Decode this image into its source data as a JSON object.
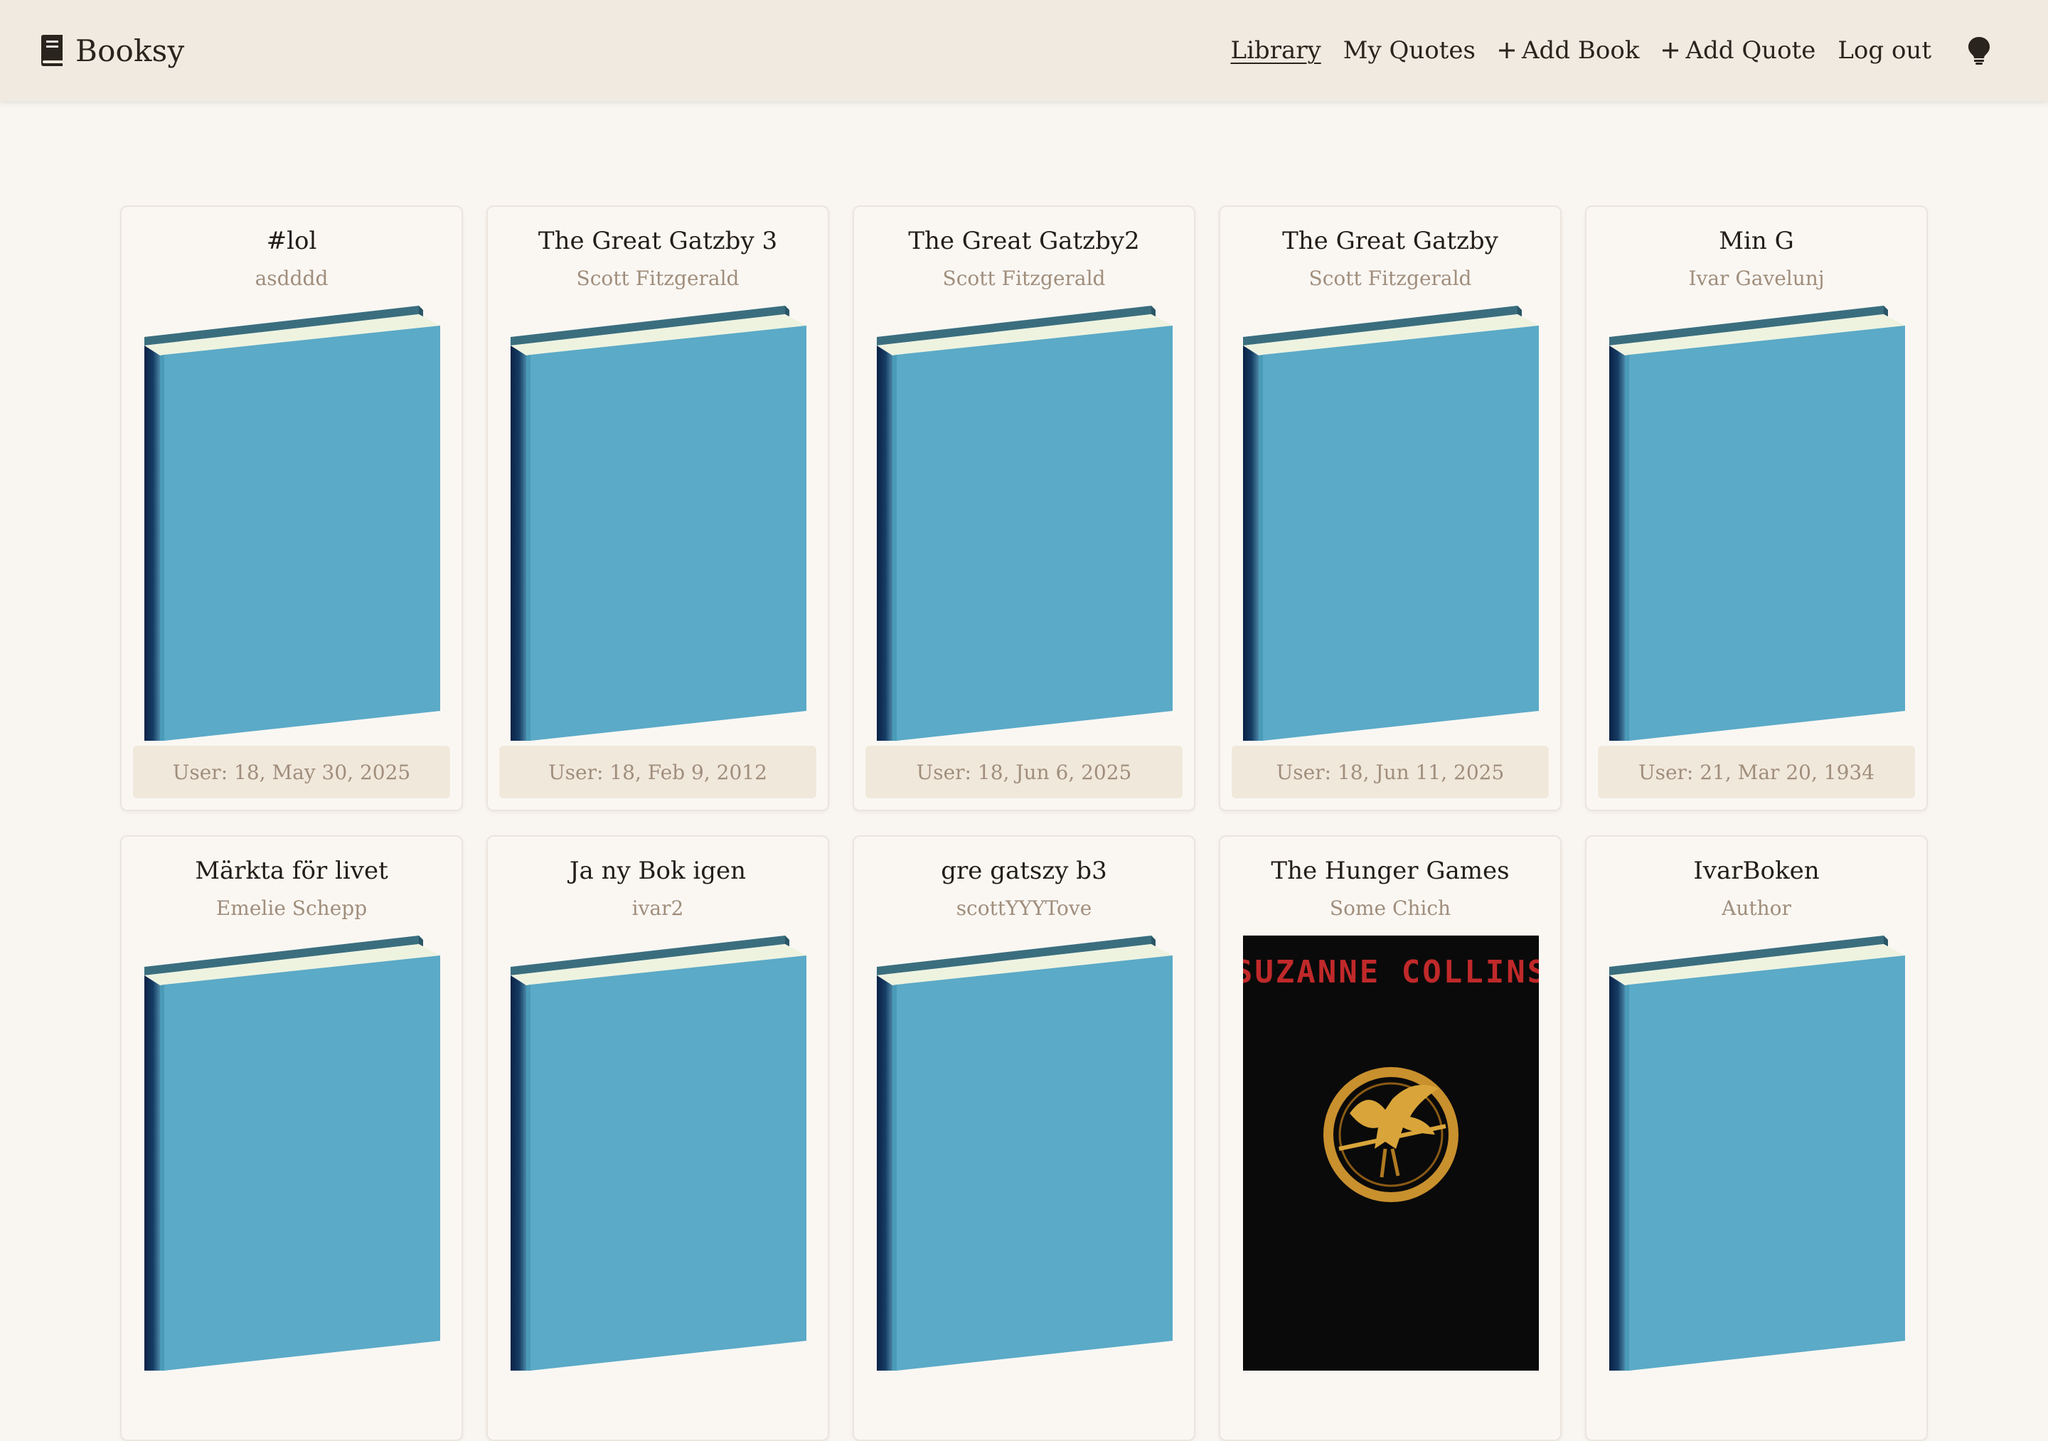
{
  "app": {
    "brand": "Booksy",
    "brand_icon": "book-icon"
  },
  "nav": {
    "library": "Library",
    "my_quotes": "My Quotes",
    "add_book": "Add Book",
    "add_quote": "Add Quote",
    "logout": "Log out",
    "theme_icon": "lightbulb-icon",
    "active": "Library"
  },
  "colors": {
    "navbar_bg": "#f1eae0",
    "page_bg": "#f9f6f2",
    "book_cover": "#5baac7",
    "book_spine": "#0e2a4e",
    "book_top": "#3a6e7e",
    "book_pages": "#eef3e0"
  },
  "books": [
    {
      "title": "#lol",
      "author": "asdddd",
      "footer": "User: 18, May 30, 2025",
      "cover": "placeholder"
    },
    {
      "title": "The Great Gatzby 3",
      "author": "Scott Fitzgerald",
      "footer": "User: 18, Feb 9, 2012",
      "cover": "placeholder"
    },
    {
      "title": "The Great Gatzby2",
      "author": "Scott Fitzgerald",
      "footer": "User: 18, Jun 6, 2025",
      "cover": "placeholder"
    },
    {
      "title": "The Great Gatzby",
      "author": "Scott Fitzgerald",
      "footer": "User: 18, Jun 11, 2025",
      "cover": "placeholder"
    },
    {
      "title": "Min G",
      "author": "Ivar Gavelunj",
      "footer": "User: 21, Mar 20, 1934",
      "cover": "placeholder"
    },
    {
      "title": "Märkta för livet",
      "author": "Emelie Schepp",
      "footer": "",
      "cover": "placeholder"
    },
    {
      "title": "Ja ny Bok igen",
      "author": "ivar2",
      "footer": "",
      "cover": "placeholder"
    },
    {
      "title": "gre gatszy b3",
      "author": "scottYYYTove",
      "footer": "",
      "cover": "placeholder"
    },
    {
      "title": "The Hunger Games",
      "author": "Some Chich",
      "footer": "",
      "cover": "image",
      "cover_text": "SUZANNE COLLINS"
    },
    {
      "title": "IvarBoken",
      "author": "Author",
      "footer": "",
      "cover": "placeholder"
    }
  ]
}
